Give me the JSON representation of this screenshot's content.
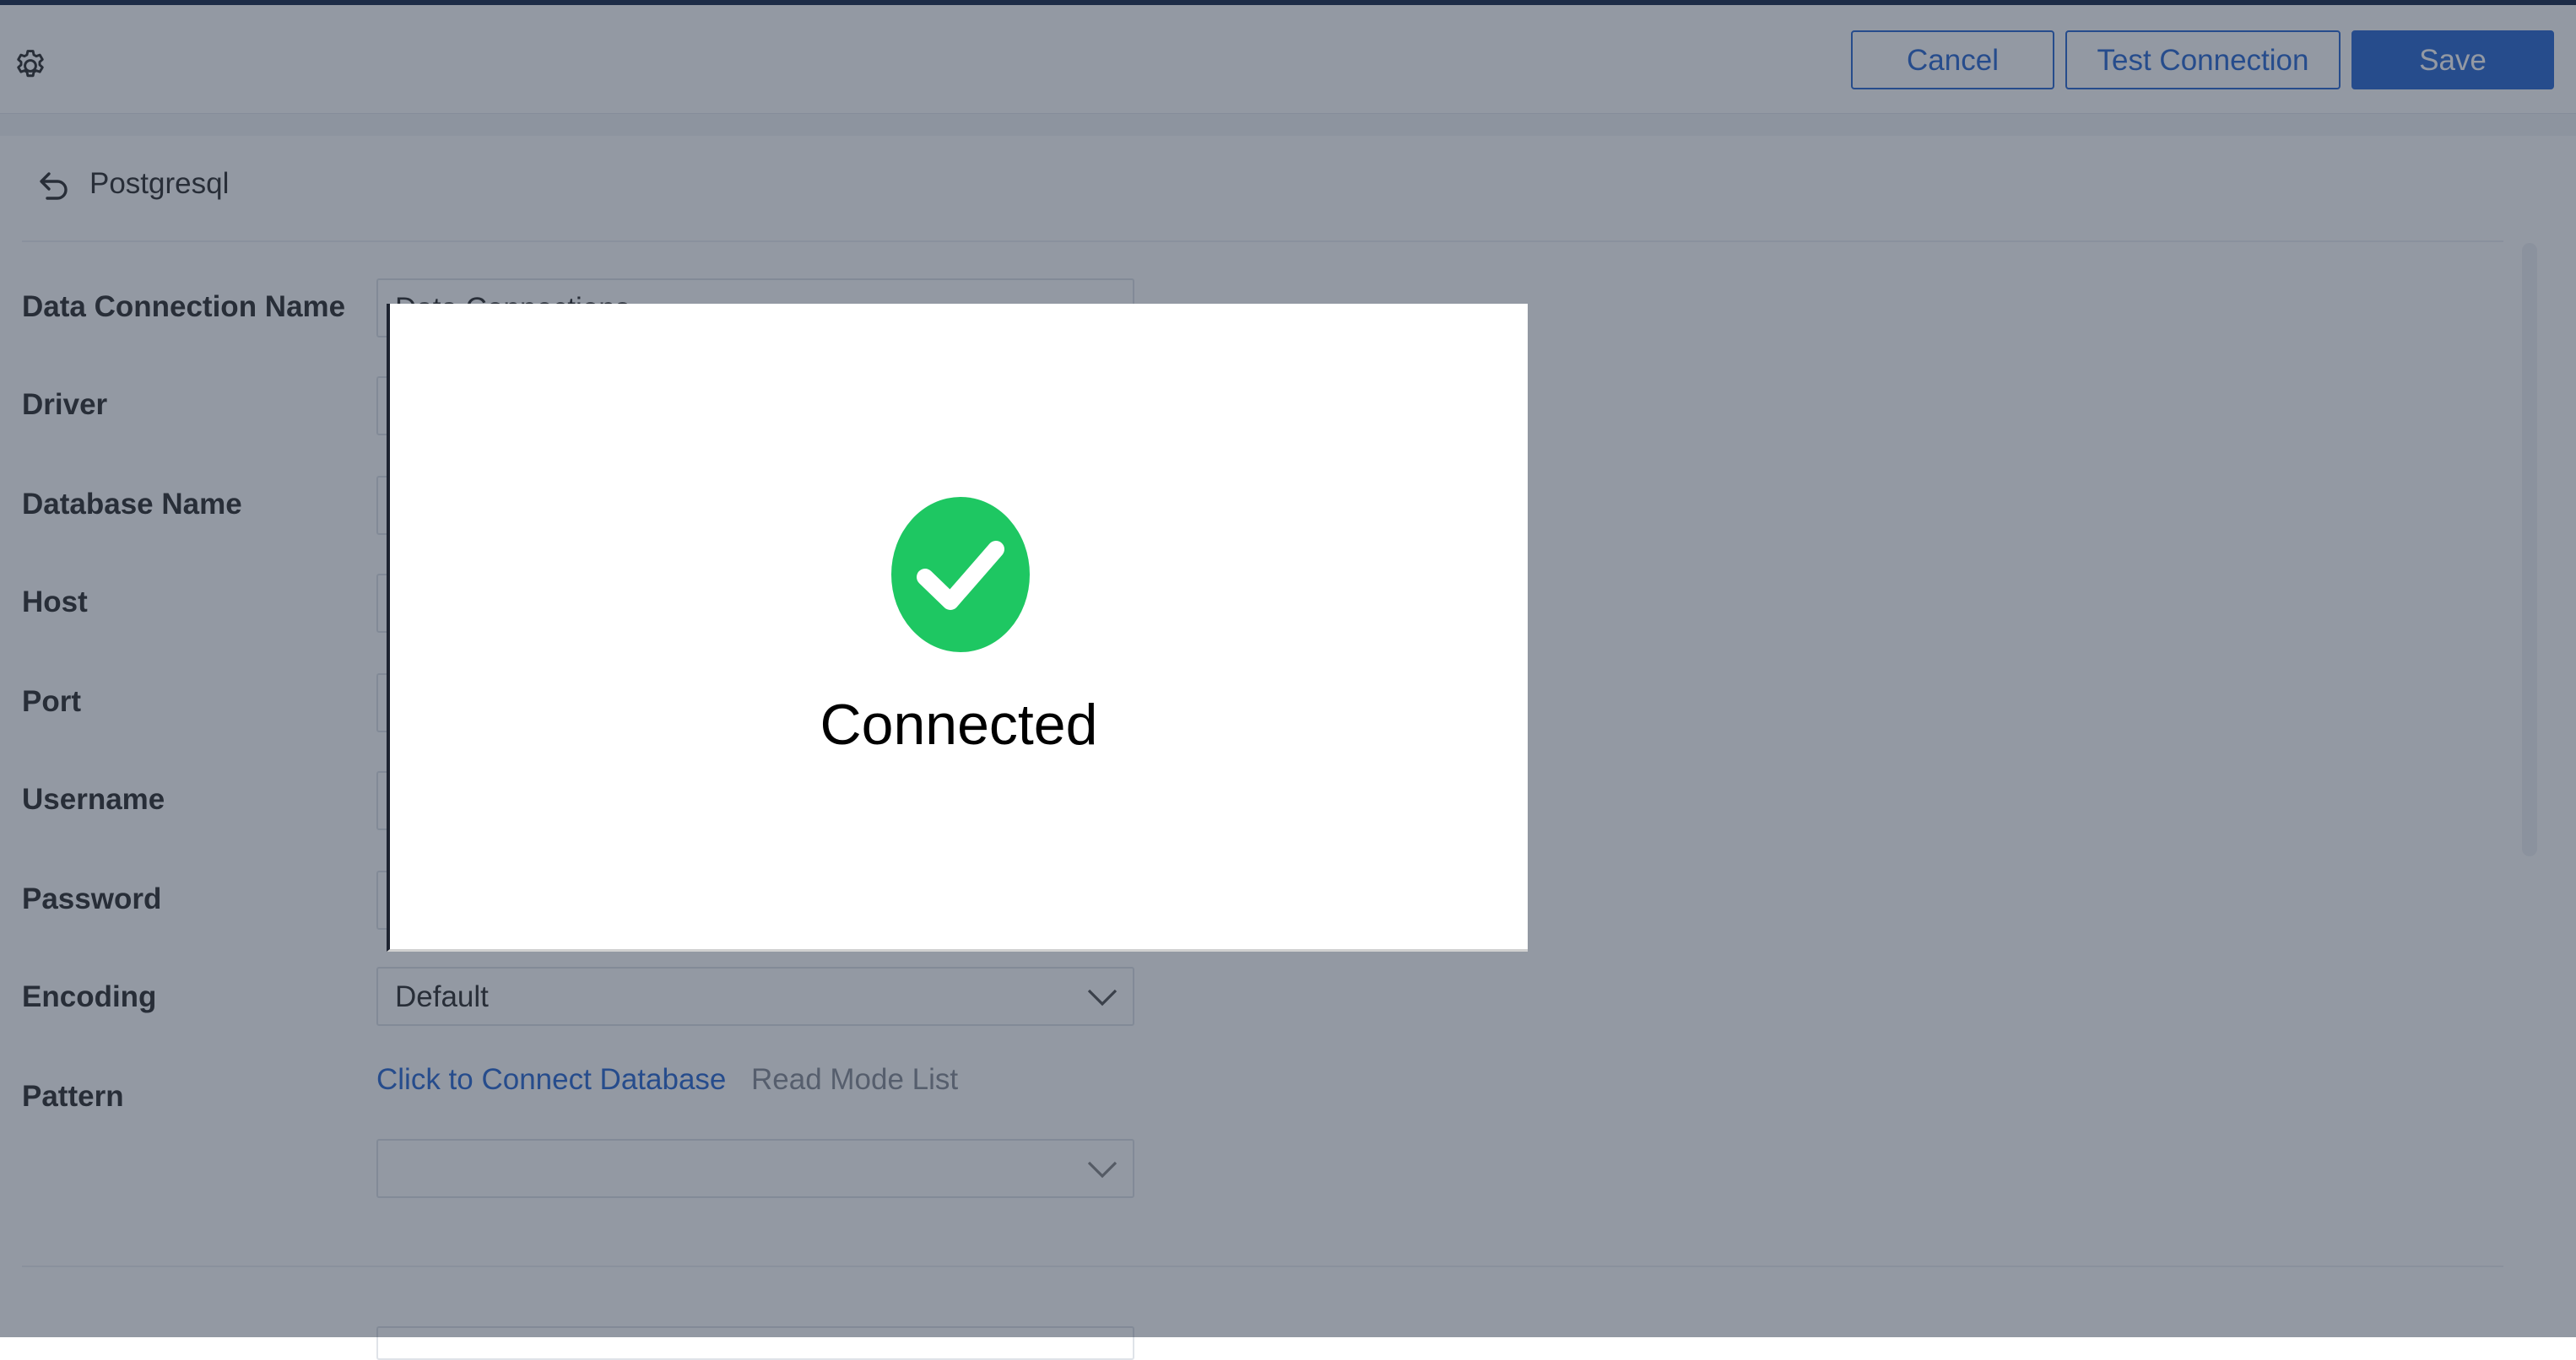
{
  "toolbar": {
    "cancel_label": "Cancel",
    "test_label": "Test Connection",
    "save_label": "Save"
  },
  "breadcrumb": {
    "label": "Postgresql"
  },
  "form": {
    "labels": {
      "name": "Data Connection Name",
      "driver": "Driver",
      "database": "Database Name",
      "host": "Host",
      "port": "Port",
      "username": "Username",
      "password": "Password",
      "encoding": "Encoding",
      "pattern": "Pattern"
    },
    "name_value": "Data Connections",
    "encoding_value": "Default",
    "pattern_links": {
      "connect": "Click to Connect Database",
      "read_mode": "Read Mode List"
    }
  },
  "modal": {
    "message": "Connected"
  },
  "colors": {
    "accent": "#2f6bd3",
    "success": "#1ec762",
    "overlay": "rgba(30,42,62,0.48)"
  },
  "icons": [
    "gear-icon",
    "back-icon",
    "chevron-down-icon",
    "check-circle-icon"
  ]
}
